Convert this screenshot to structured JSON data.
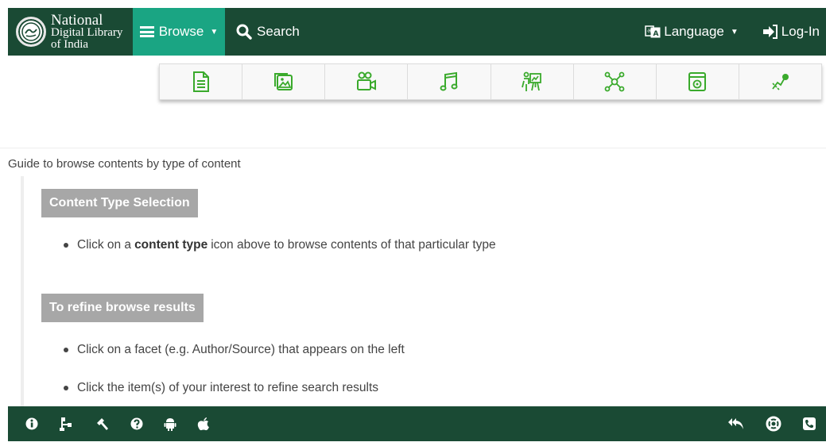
{
  "header": {
    "logo_line1": "National",
    "logo_line2": "Digital Library",
    "logo_line3": "of India",
    "browse_label": "Browse",
    "search_label": "Search",
    "language_label": "Language",
    "login_label": "Log-In"
  },
  "content_types": [
    {
      "icon": "document-icon"
    },
    {
      "icon": "image-icon"
    },
    {
      "icon": "video-icon"
    },
    {
      "icon": "audio-icon"
    },
    {
      "icon": "presentation-icon"
    },
    {
      "icon": "network-icon"
    },
    {
      "icon": "web-icon"
    },
    {
      "icon": "other-icon"
    }
  ],
  "guide": {
    "title": "Guide to browse contents by type of content",
    "section1_title": "Content Type Selection",
    "section1_pre": "Click on a",
    "section1_bold": "content type",
    "section1_post": "icon above to browse contents of that particular type",
    "section2_title": "To refine browse results",
    "section2_item1": "Click on a facet (e.g. Author/Source) that appears on the left",
    "section2_item2": "Click the item(s) of your interest to refine search results"
  },
  "footer": {
    "left_icons": [
      "info-icon",
      "sitemap-icon",
      "tools-icon",
      "help-icon",
      "android-icon",
      "apple-icon"
    ],
    "right_icons": [
      "reply-all-icon",
      "lifebuoy-icon",
      "phone-icon"
    ]
  },
  "colors": {
    "primary": "#1a4a34",
    "accent": "#1aa583",
    "icon_green": "#3aaa2c",
    "section_gray": "#a7a7a7"
  }
}
